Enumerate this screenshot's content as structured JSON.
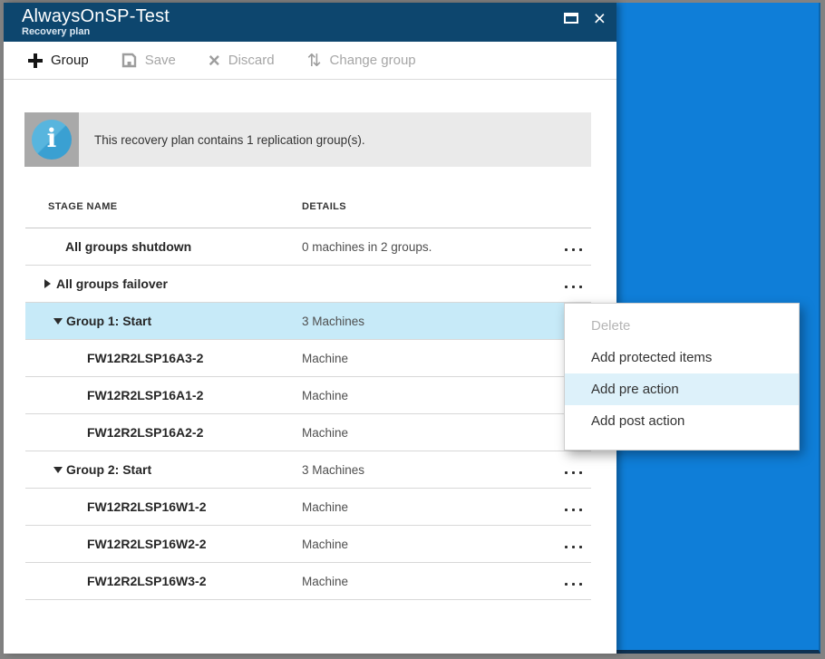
{
  "window": {
    "title": "AlwaysOnSP-Test",
    "subtitle": "Recovery plan",
    "close_glyph": "×"
  },
  "toolbar": {
    "group": {
      "label": "Group",
      "enabled": true
    },
    "save": {
      "label": "Save",
      "enabled": false
    },
    "discard": {
      "label": "Discard",
      "enabled": false,
      "glyph": "×"
    },
    "change_group": {
      "label": "Change group",
      "enabled": false,
      "glyph": "⇅"
    }
  },
  "banner": {
    "message": "This recovery plan contains 1 replication group(s).",
    "icon_glyph": "i"
  },
  "table": {
    "header": {
      "stage": "STAGE NAME",
      "details": "DETAILS"
    },
    "rows": [
      {
        "name": "All groups shutdown",
        "details": "0 machines in 2 groups.",
        "type": "stage",
        "expander": "none",
        "selected": false
      },
      {
        "name": "All groups failover",
        "details": "",
        "type": "stage",
        "expander": "collapsed",
        "selected": false
      },
      {
        "name": "Group 1: Start",
        "details": "3 Machines",
        "type": "group",
        "expander": "expanded",
        "selected": true
      },
      {
        "name": "FW12R2LSP16A3-2",
        "details": "Machine",
        "type": "machine",
        "expander": "none",
        "selected": false
      },
      {
        "name": "FW12R2LSP16A1-2",
        "details": "Machine",
        "type": "machine",
        "expander": "none",
        "selected": false
      },
      {
        "name": "FW12R2LSP16A2-2",
        "details": "Machine",
        "type": "machine",
        "expander": "none",
        "selected": false
      },
      {
        "name": "Group 2: Start",
        "details": "3 Machines",
        "type": "group",
        "expander": "expanded",
        "selected": false
      },
      {
        "name": "FW12R2LSP16W1-2",
        "details": "Machine",
        "type": "machine",
        "expander": "none",
        "selected": false
      },
      {
        "name": "FW12R2LSP16W2-2",
        "details": "Machine",
        "type": "machine",
        "expander": "none",
        "selected": false
      },
      {
        "name": "FW12R2LSP16W3-2",
        "details": "Machine",
        "type": "machine",
        "expander": "none",
        "selected": false
      }
    ]
  },
  "context_menu": {
    "items": [
      {
        "label": "Delete",
        "enabled": false,
        "highlighted": false
      },
      {
        "label": "Add protected items",
        "enabled": true,
        "highlighted": false
      },
      {
        "label": "Add pre action",
        "enabled": true,
        "highlighted": true
      },
      {
        "label": "Add post action",
        "enabled": true,
        "highlighted": false
      }
    ]
  },
  "colors": {
    "header_bar": "#0d466e",
    "portal_background": "#0f7ed8",
    "selected_row": "#c7eaf8",
    "menu_hover": "#ddf1fa",
    "info_icon": "#3aa0d2"
  }
}
